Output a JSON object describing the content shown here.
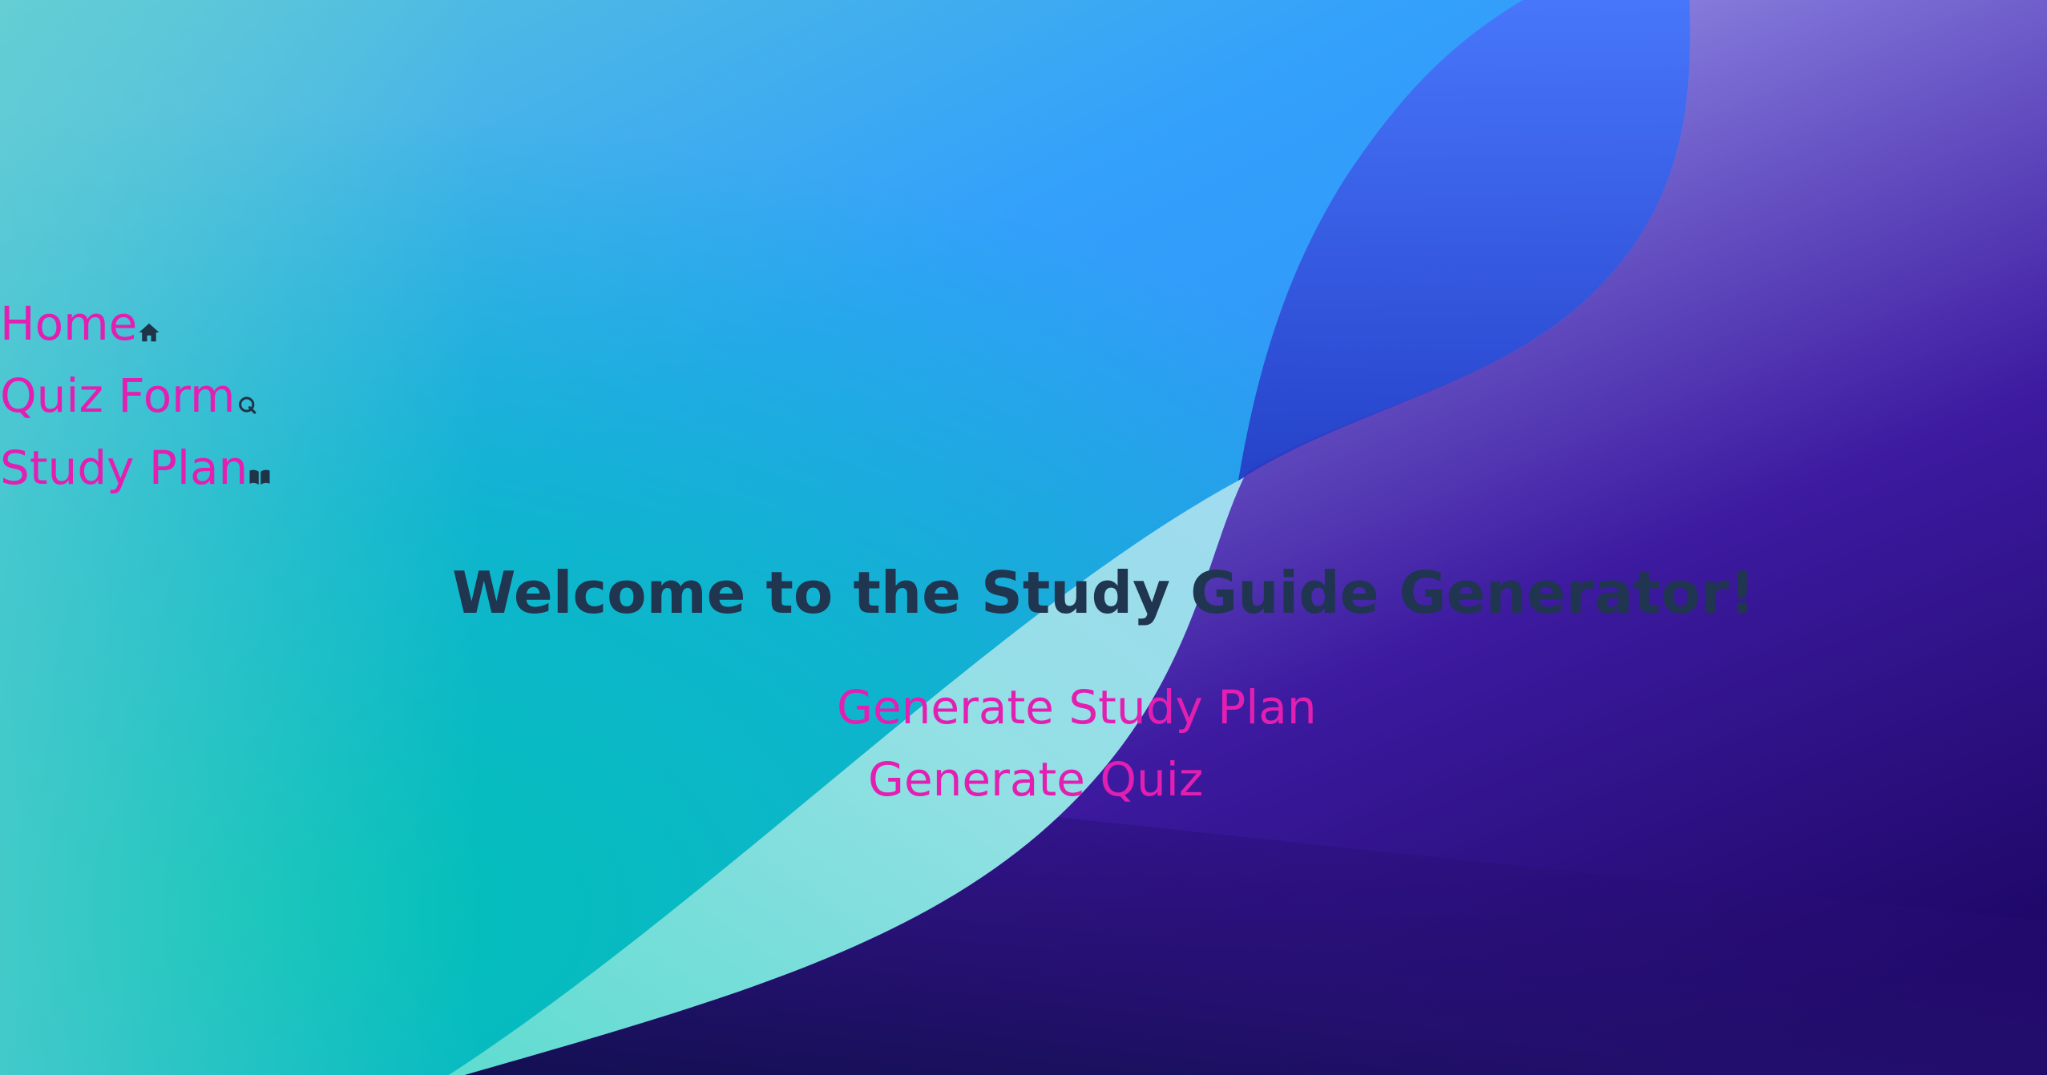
{
  "theme": {
    "link_color": "#e31fb2",
    "title_color": "#203550",
    "icon_color": "#1f3349",
    "wallpaper_colors": [
      "#62d0cd",
      "#339bff",
      "#00c0b8",
      "#4a6df7",
      "#260a78",
      "#b9bdfc",
      "#8ee1de"
    ]
  },
  "nav": {
    "items": [
      {
        "label": "Home",
        "icon": "home-icon"
      },
      {
        "label": "Quiz Form",
        "icon": "quiz-icon"
      },
      {
        "label": "Study Plan",
        "icon": "book-icon"
      }
    ]
  },
  "main": {
    "title": "Welcome to the Study Guide Generator!",
    "actions": [
      {
        "label": "Generate Study Plan"
      },
      {
        "label": "Generate Quiz"
      }
    ]
  }
}
